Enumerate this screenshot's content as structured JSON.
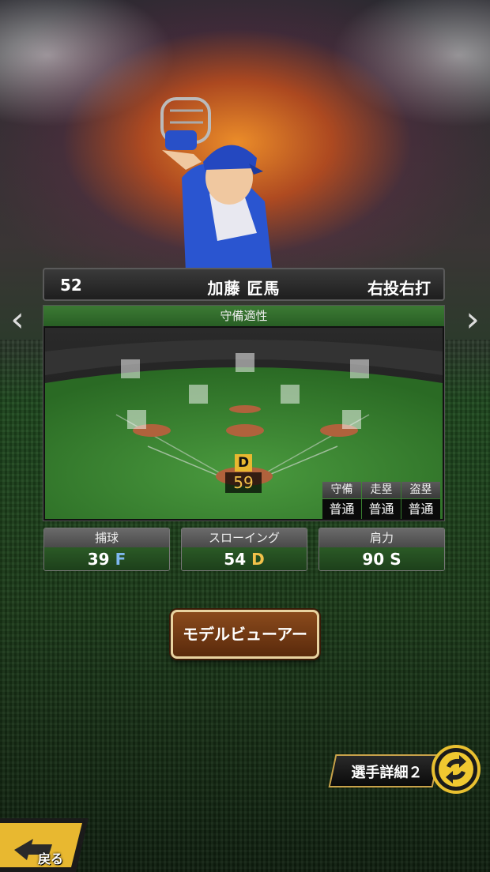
{
  "player": {
    "number": "52",
    "name": "加藤 匠馬",
    "throw_bat": "右投右打"
  },
  "defense": {
    "title": "守備適性",
    "position_grade": "D",
    "position_value": "59",
    "stats_table": {
      "headers": [
        "守備",
        "走塁",
        "盗塁"
      ],
      "values": [
        "普通",
        "普通",
        "普通"
      ]
    }
  },
  "abilities": [
    {
      "label": "捕球",
      "value": "39",
      "grade": "F",
      "grade_color": "#7fb8f0"
    },
    {
      "label": "スローイング",
      "value": "54",
      "grade": "D",
      "grade_color": "#f2c14a"
    },
    {
      "label": "肩力",
      "value": "90",
      "grade": "S",
      "grade_color": "#ffffff"
    }
  ],
  "buttons": {
    "model_viewer": "モデルビューアー",
    "player_detail": "選手詳細２",
    "back": "戻る"
  },
  "icons": {
    "prev": "chevron-left-icon",
    "next": "chevron-right-icon",
    "swap": "swap-arrows-icon",
    "back": "back-arrow-icon"
  },
  "colors": {
    "header_green": "#3c7a34",
    "accent_gold": "#f2c14a",
    "button_brown": "#8a4a1c"
  }
}
